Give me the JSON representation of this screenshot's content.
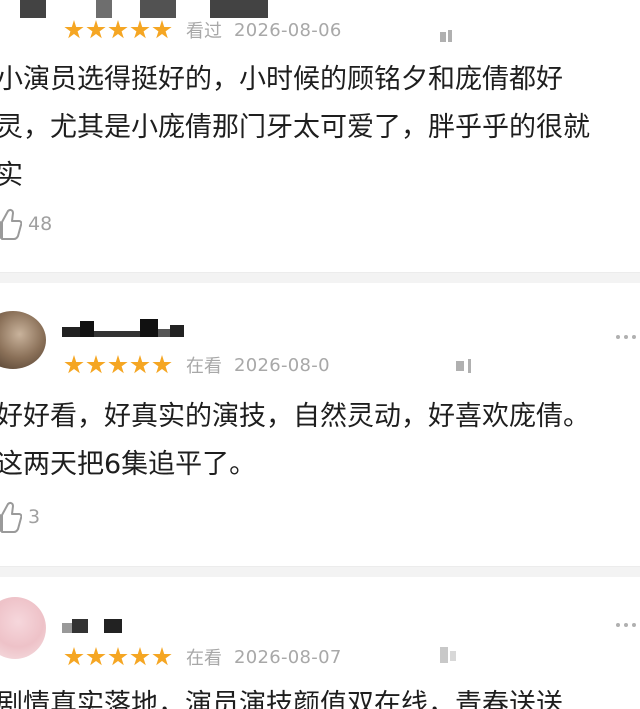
{
  "reviews": [
    {
      "status": "看过",
      "date": "2026-08-06",
      "rating": 5,
      "text_lines": [
        "小演员选得挺好的，小时候的顾铭夕和庞倩都好",
        "灵，尤其是小庞倩那门牙太可爱了，胖乎乎的很就",
        "实"
      ],
      "likes": "48"
    },
    {
      "status": "在看",
      "date": "2026-08-0",
      "rating": 5,
      "text_lines": [
        "好好看，好真实的演技，自然灵动，好喜欢庞倩。",
        "这两天把6集追平了。"
      ],
      "likes": "3"
    },
    {
      "status": "在看",
      "date": "2026-08-07",
      "rating": 5,
      "text_lines": [
        "剧情真实落地，演员演技颜值双在线，青春送送"
      ],
      "likes": ""
    }
  ],
  "icons": {
    "star": "star-icon",
    "like": "thumb-up-icon",
    "more": "more-options-icon"
  },
  "colors": {
    "star": "#f5a623",
    "meta_text": "#a8a8a8",
    "body_text": "#1e1e1e",
    "divider": "#f3f3f3"
  }
}
